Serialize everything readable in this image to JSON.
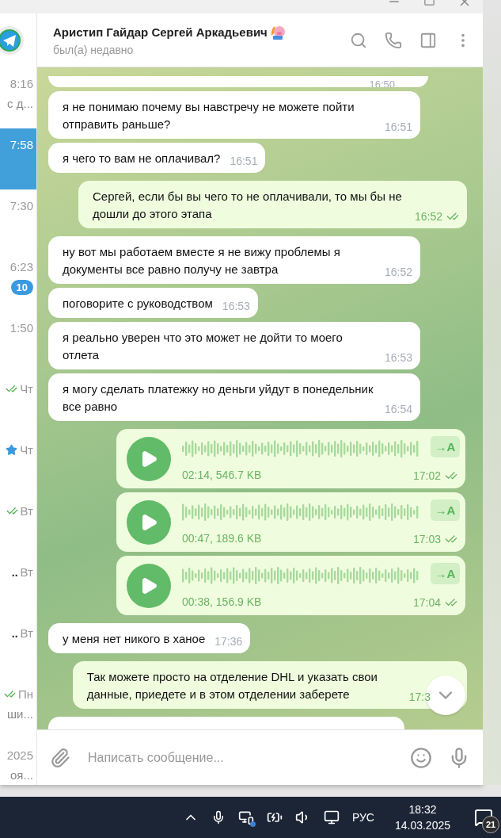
{
  "chat_list": [
    {
      "time": "8:16",
      "preview": "с д...",
      "selected": false,
      "read": false,
      "starred": false
    },
    {
      "time": "7:58",
      "selected": true,
      "read": false,
      "starred": false
    },
    {
      "time": "7:30",
      "selected": false,
      "read": false,
      "starred": false
    },
    {
      "time": "6:23",
      "badge": "10",
      "selected": false,
      "read": false,
      "starred": false
    },
    {
      "time": "1:50",
      "selected": false,
      "read": false,
      "starred": false
    },
    {
      "time": "Чт",
      "selected": false,
      "read": true,
      "starred": false
    },
    {
      "time": "Чт",
      "selected": false,
      "read": false,
      "starred": true
    },
    {
      "time": "Вт",
      "selected": false,
      "read": true,
      "starred": false
    },
    {
      "time": "Вт",
      "tail": "..",
      "selected": false,
      "read": false,
      "starred": false
    },
    {
      "time": "Вт",
      "tail": "..",
      "selected": false,
      "read": false,
      "starred": false
    },
    {
      "time": "Пн",
      "preview": "ши...",
      "selected": false,
      "read": true,
      "starred": false
    },
    {
      "time": "2025",
      "preview": "оя...",
      "selected": false,
      "read": false,
      "starred": false
    }
  ],
  "header": {
    "name": "Аристип Гайдар Сергей Аркадьевич",
    "status": "был(а) недавно"
  },
  "messages": [
    {
      "kind": "cut_top",
      "outgoing": false,
      "time": "16:50"
    },
    {
      "kind": "text",
      "outgoing": false,
      "text": "я не понимаю почему вы навстречу не можете пойти отправить раньше?",
      "time": "16:51"
    },
    {
      "kind": "text",
      "outgoing": false,
      "text": "я чего то вам не оплачивал?",
      "time": "16:51"
    },
    {
      "kind": "text",
      "outgoing": true,
      "text": "Сергей, если бы вы чего то не оплачивали, то мы бы не дошли до этого этапа",
      "time": "16:52",
      "read": true
    },
    {
      "kind": "text",
      "outgoing": false,
      "text": "ну вот мы работаем вместе я не вижу проблемы я документы все равно получу не завтра",
      "time": "16:52"
    },
    {
      "kind": "text",
      "outgoing": false,
      "text": "поговорите с руководством",
      "time": "16:53"
    },
    {
      "kind": "text",
      "outgoing": false,
      "text": "я реально уверен что это может не дойти то моего отлета",
      "time": "16:53"
    },
    {
      "kind": "text",
      "outgoing": false,
      "text": "я могу сделать платежку но деньги уйдут в понедельник все равно",
      "time": "16:54"
    },
    {
      "kind": "voice",
      "outgoing": true,
      "meta": "02:14, 546.7 KB",
      "transcribe": "→A",
      "time": "17:02",
      "read": true
    },
    {
      "kind": "voice",
      "outgoing": true,
      "meta": "00:47, 189.6 KB",
      "transcribe": "→A",
      "time": "17:03",
      "read": true
    },
    {
      "kind": "voice",
      "outgoing": true,
      "meta": "00:38, 156.9 KB",
      "transcribe": "→A",
      "time": "17:04",
      "read": true
    },
    {
      "kind": "text",
      "outgoing": false,
      "text": "у меня нет никого в ханое",
      "time": "17:36"
    },
    {
      "kind": "text",
      "outgoing": true,
      "text": "Так можете просто на отделение DHL и указать свои данные, приедете и в этом отделении заберете",
      "time": "17:3"
    },
    {
      "kind": "cut_bottom",
      "outgoing": false
    }
  ],
  "composer": {
    "placeholder": "Написать сообщение..."
  },
  "taskbar": {
    "language": "РУС",
    "time": "18:32",
    "date": "14.03.2025",
    "notifications": "21"
  }
}
